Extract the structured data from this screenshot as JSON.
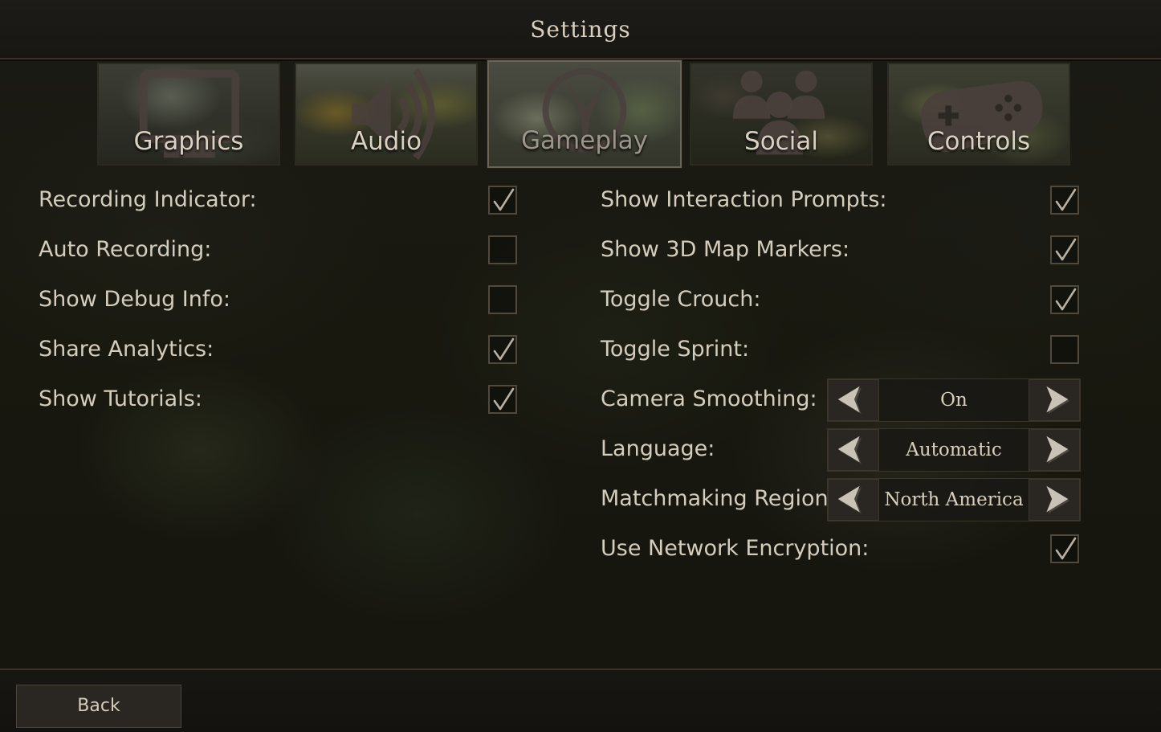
{
  "window": {
    "title": "Settings"
  },
  "tabs": [
    {
      "label": "Graphics",
      "icon": "monitor-icon",
      "active": false
    },
    {
      "label": "Audio",
      "icon": "speaker-icon",
      "active": false
    },
    {
      "label": "Gameplay",
      "icon": "footprint-icon",
      "active": true
    },
    {
      "label": "Social",
      "icon": "group-icon",
      "active": false
    },
    {
      "label": "Controls",
      "icon": "gamepad-icon",
      "active": false
    }
  ],
  "left_settings": [
    {
      "label": "Recording Indicator:",
      "checked": true
    },
    {
      "label": "Auto Recording:",
      "checked": false
    },
    {
      "label": "Show Debug Info:",
      "checked": false
    },
    {
      "label": "Share Analytics:",
      "checked": true
    },
    {
      "label": "Show Tutorials:",
      "checked": true
    }
  ],
  "right_settings": [
    {
      "label": "Show Interaction Prompts:",
      "type": "checkbox",
      "checked": true
    },
    {
      "label": "Show 3D Map Markers:",
      "type": "checkbox",
      "checked": true
    },
    {
      "label": "Toggle Crouch:",
      "type": "checkbox",
      "checked": true
    },
    {
      "label": "Toggle Sprint:",
      "type": "checkbox",
      "checked": false
    },
    {
      "label": "Camera Smoothing:",
      "type": "selector",
      "value": "On"
    },
    {
      "label": "Language:",
      "type": "selector",
      "value": "Automatic"
    },
    {
      "label": "Matchmaking Region:",
      "type": "selector",
      "value": "North America"
    },
    {
      "label": "Use Network Encryption:",
      "type": "checkbox",
      "checked": true
    }
  ],
  "footer": {
    "back_label": "Back"
  },
  "colors": {
    "text": "#d4cdbd",
    "checkmark": "#b8b0a2",
    "checkbox_border": "#514a3c",
    "arrow": "#c9c3b7",
    "arrow_shadow": "#4a4640",
    "background": "#18180f"
  }
}
